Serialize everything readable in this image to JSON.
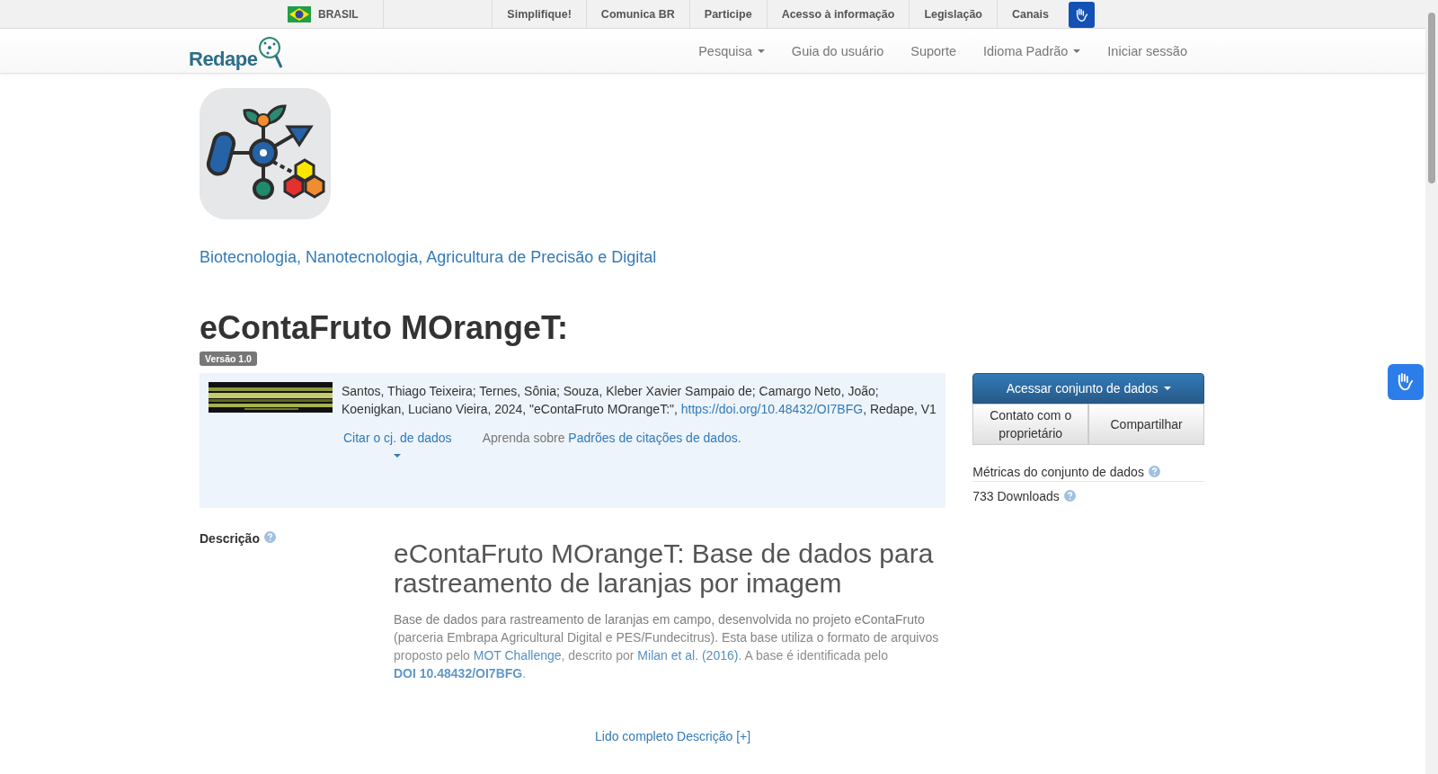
{
  "gov_bar": {
    "country": "BRASIL",
    "links": [
      "Simplifique!",
      "Comunica BR",
      "Participe",
      "Acesso à informação",
      "Legislação",
      "Canais"
    ]
  },
  "navbar": {
    "brand": "Redape",
    "items": [
      {
        "label": "Pesquisa",
        "dropdown": true
      },
      {
        "label": "Guia do usuário",
        "dropdown": false
      },
      {
        "label": "Suporte",
        "dropdown": false
      },
      {
        "label": "Idioma Padrão",
        "dropdown": true
      },
      {
        "label": "Iniciar sessão",
        "dropdown": false
      }
    ]
  },
  "collection": {
    "name": "Biotecnologia, Nanotecnologia, Agricultura de Precisão e Digital"
  },
  "dataset": {
    "title": "eContaFruto MOrangeT:",
    "version": "Versão 1.0",
    "citation": [
      {
        "kind": "text",
        "text": "Santos, Thiago Teixeira; Ternes, Sônia; Souza, Kleber Xavier Sampaio de; Camargo Neto, João; Koenigkan, Luciano Vieira, 2024, \"eContaFruto MOrangeT:\", "
      },
      {
        "kind": "link",
        "text": "https://doi.org/10.48432/OI7BFG"
      },
      {
        "kind": "text",
        "text": ", Redape, V1"
      }
    ],
    "cite_button": "Citar o cj. de dados",
    "learn_prefix": "Aprenda sobre",
    "learn_link": "Padrões de citações de dados."
  },
  "actions": {
    "primary": "Acessar conjunto de dados",
    "secondary": [
      "Contato com o proprietário",
      "Compartilhar"
    ]
  },
  "metrics": {
    "title": "Métricas do conjunto de dados",
    "downloads": "733 Downloads"
  },
  "description": {
    "label": "Descrição",
    "heading": "eContaFruto MOrangeT: Base de dados para rastreamento de laranjas por imagem",
    "paragraph": [
      {
        "kind": "text",
        "text": "Base de dados para rastreamento de laranjas em campo, desenvolvida no projeto eContaFruto (parceria Embrapa Agricultural Digital e PES/Fundecitrus). Esta base utiliza o formato de arquivos proposto pelo "
      },
      {
        "kind": "link",
        "text": "MOT Challenge"
      },
      {
        "kind": "text",
        "text": ", descrito por "
      },
      {
        "kind": "link",
        "text": "Milan et al. (2016)"
      },
      {
        "kind": "text",
        "text": ". A base é identificada pelo "
      },
      {
        "kind": "boldlink",
        "text": "DOI 10.48432/OI7BFG"
      },
      {
        "kind": "text",
        "text": "."
      }
    ],
    "read_more": "Lido completo Descrição [+]"
  }
}
